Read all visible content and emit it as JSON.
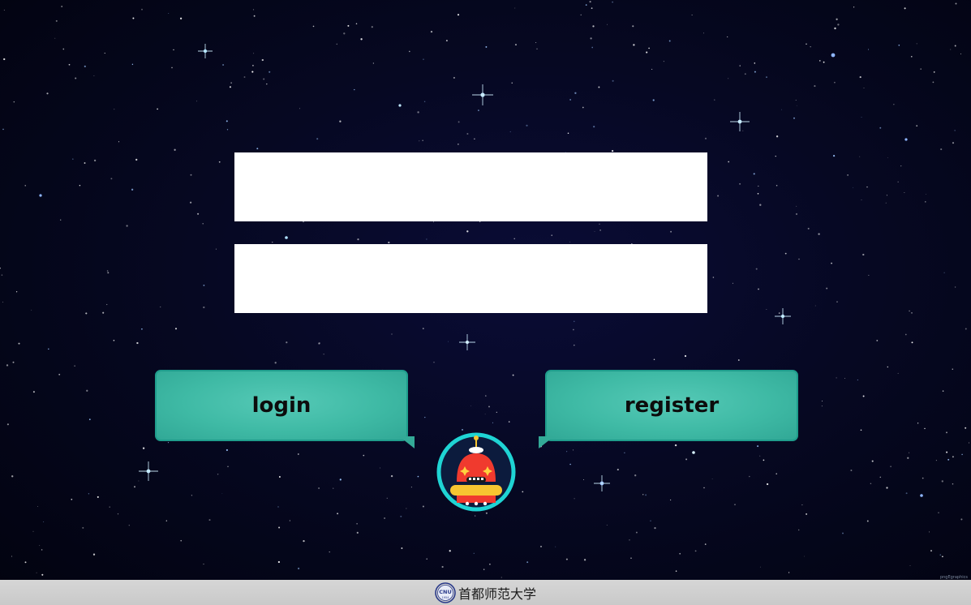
{
  "form": {
    "username_value": "",
    "password_value": ""
  },
  "buttons": {
    "login_label": "login",
    "register_label": "register"
  },
  "mascot": {
    "icon": "robot-icon"
  },
  "footer": {
    "logo_text": "CNU",
    "logo_year": "1954",
    "university_name": "首都师范大学"
  },
  "credit": {
    "text": "pngEgraphics"
  },
  "colors": {
    "background": "#060822",
    "button": "#3fbaa5",
    "button_border": "#1f9d8c",
    "mascot_ring": "#1fd4d4",
    "robot_body": "#f03a2e",
    "robot_belt": "#f7c531",
    "footer_bg": "#cfcfcf"
  }
}
